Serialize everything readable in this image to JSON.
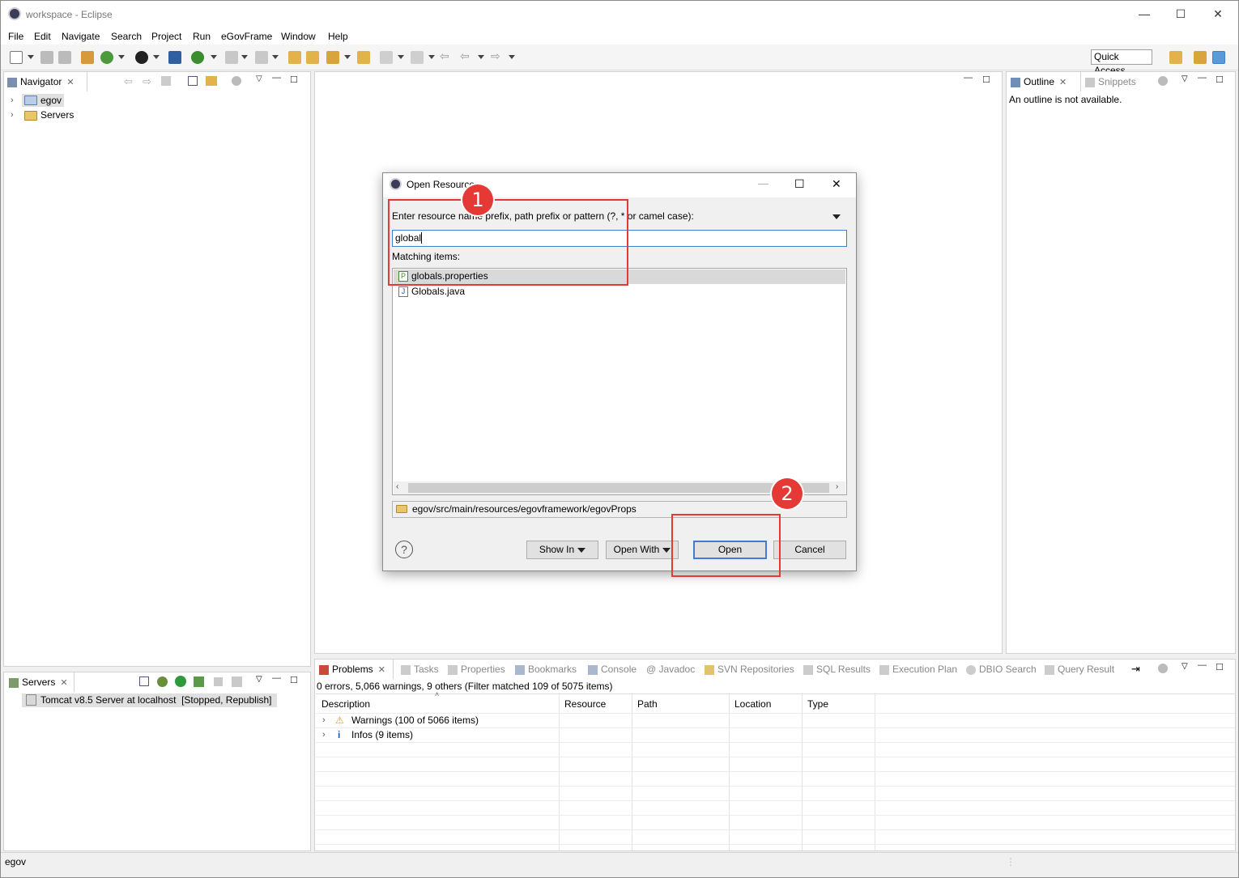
{
  "window": {
    "title": "workspace - Eclipse",
    "minimize": "—",
    "maximize": "☐",
    "close": "✕"
  },
  "menu": [
    "File",
    "Edit",
    "Navigate",
    "Search",
    "Project",
    "Run",
    "eGovFrame",
    "Window",
    "Help"
  ],
  "toolbar": {
    "quick_access": "Quick Access"
  },
  "navigator": {
    "tab": "Navigator",
    "items": [
      {
        "label": "egov"
      },
      {
        "label": "Servers"
      }
    ]
  },
  "outline": {
    "tabs": [
      "Outline",
      "Snippets"
    ],
    "message": "An outline is not available."
  },
  "servers_view": {
    "tab": "Servers",
    "entry": "Tomcat v8.5 Server at localhost  [Stopped, Republish]"
  },
  "bottom_tabs": [
    "Problems",
    "Tasks",
    "Properties",
    "Bookmarks",
    "Console",
    "@ Javadoc",
    "SVN Repositories",
    "SQL Results",
    "Execution Plan",
    "DBIO Search",
    "Query Result"
  ],
  "problems": {
    "summary": "0 errors, 5,066 warnings, 9 others (Filter matched 109 of 5075 items)",
    "columns": [
      "Description",
      "Resource",
      "Path",
      "Location",
      "Type"
    ],
    "rows": [
      {
        "label": "Warnings (100 of 5066 items)"
      },
      {
        "label": "Infos (9 items)"
      }
    ]
  },
  "dialog": {
    "title": "Open Resource",
    "prompt": "Enter resource name prefix, path prefix or pattern (?, * or camel case):",
    "input_value": "global",
    "matching_label": "Matching items:",
    "items": [
      {
        "label": "globals.properties",
        "icon": "properties-file-icon",
        "selected": true
      },
      {
        "label": "Globals.java",
        "icon": "java-file-icon",
        "selected": false
      }
    ],
    "path": "egov/src/main/resources/egovframework/egovProps",
    "buttons": {
      "show_in": "Show In",
      "open_with": "Open With",
      "open": "Open",
      "cancel": "Cancel"
    },
    "help": "?"
  },
  "annotations": {
    "first": "1",
    "second": "2"
  },
  "status": {
    "left": "egov"
  },
  "colors": {
    "annotation_red": "#e53935",
    "focus_blue": "#3c7fd0"
  }
}
